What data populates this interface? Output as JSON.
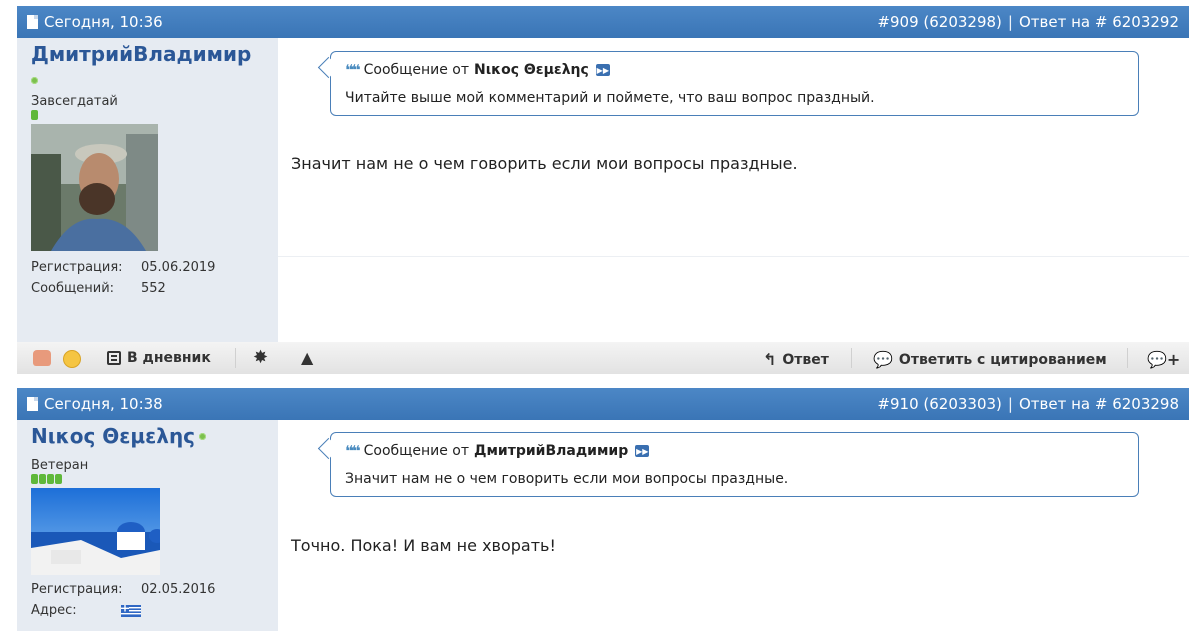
{
  "posts": [
    {
      "date": "Сегодня, 10:36",
      "post_number": "#909 (6203298)",
      "reply_to": "Ответ на # 6203292",
      "username": "ДмитрийВладимир",
      "user_title": "Завсегдатай",
      "registration_label": "Регистрация:",
      "registration_value": "05.06.2019",
      "messages_label": "Сообщений:",
      "messages_value": "552",
      "quote_prefix": "Сообщение от",
      "quote_author": "Νικος Θεμελης",
      "quote_text": "Читайте выше мой комментарий и поймете, что ваш вопрос праздный.",
      "message": "Значит нам не о чем говорить если мои вопросы праздные.",
      "rep_bars": 1
    },
    {
      "date": "Сегодня, 10:38",
      "post_number": "#910 (6203303)",
      "reply_to": "Ответ на # 6203298",
      "username": "Νικος Θεμελης",
      "user_title": "Ветеран",
      "registration_label": "Регистрация:",
      "registration_value": "02.05.2016",
      "address_label": "Адрес:",
      "quote_prefix": "Сообщение от",
      "quote_author": "ДмитрийВладимир",
      "quote_text": "Значит нам не о чем говорить если мои вопросы праздные.",
      "message": "Точно. Пока! И вам не хворать!",
      "rep_bars": 4
    }
  ],
  "toolbar": {
    "diary_label": "В дневник",
    "reply_label": "Ответ",
    "quote_reply_label": "Ответить с цитированием"
  },
  "colors": {
    "header": "#3f7bbd",
    "userinfo_bg": "#e6ebf2",
    "username": "#2b5797",
    "online": "#7cc04e",
    "quote_border": "#4a7fb8"
  }
}
